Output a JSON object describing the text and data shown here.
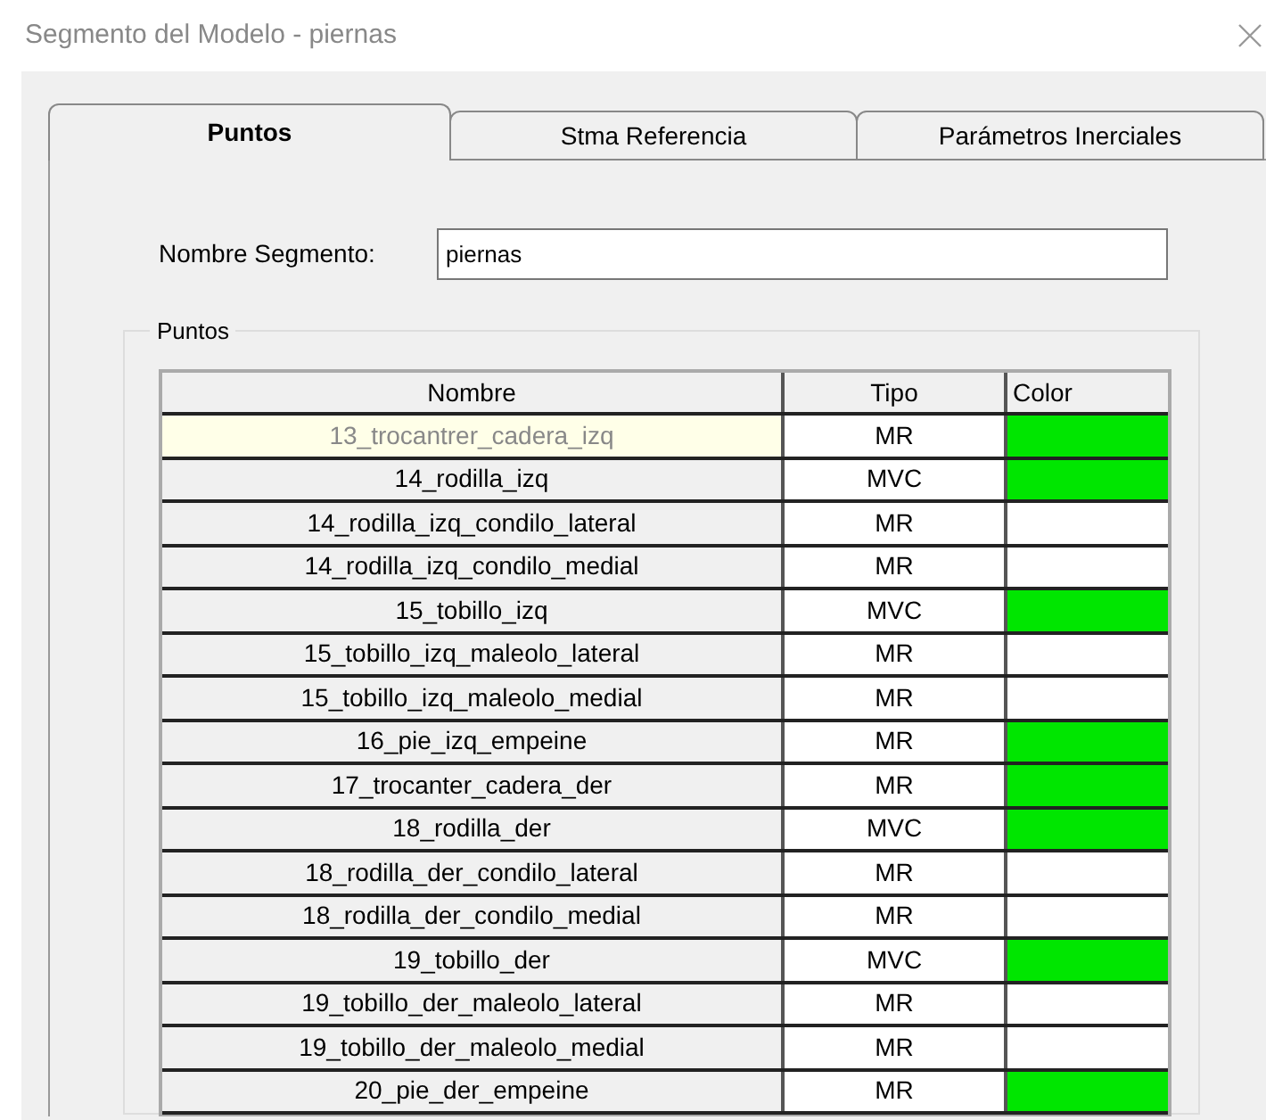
{
  "window": {
    "title": "Segmento del Modelo - piernas"
  },
  "tabs": [
    {
      "label": "Puntos",
      "selected": true
    },
    {
      "label": "Stma Referencia",
      "selected": false
    },
    {
      "label": "Parámetros Inerciales",
      "selected": false
    }
  ],
  "segment_name": {
    "label": "Nombre Segmento:",
    "value": "piernas"
  },
  "points_group": {
    "title": "Puntos",
    "columns": [
      "Nombre",
      "Tipo",
      "Color"
    ],
    "rows": [
      {
        "nombre": "13_trocantrer_cadera_izq",
        "tipo": "MR",
        "color": "#00e600",
        "selected": true
      },
      {
        "nombre": "14_rodilla_izq",
        "tipo": "MVC",
        "color": "#00e600",
        "selected": false
      },
      {
        "nombre": "14_rodilla_izq_condilo_lateral",
        "tipo": "MR",
        "selected": false
      },
      {
        "nombre": "14_rodilla_izq_condilo_medial",
        "tipo": "MR",
        "selected": false
      },
      {
        "nombre": "15_tobillo_izq",
        "tipo": "MVC",
        "color": "#00e600",
        "selected": false
      },
      {
        "nombre": "15_tobillo_izq_maleolo_lateral",
        "tipo": "MR",
        "selected": false
      },
      {
        "nombre": "15_tobillo_izq_maleolo_medial",
        "tipo": "MR",
        "selected": false
      },
      {
        "nombre": "16_pie_izq_empeine",
        "tipo": "MR",
        "color": "#00e600",
        "selected": false
      },
      {
        "nombre": "17_trocanter_cadera_der",
        "tipo": "MR",
        "color": "#00e600",
        "selected": false
      },
      {
        "nombre": "18_rodilla_der",
        "tipo": "MVC",
        "color": "#00e600",
        "selected": false
      },
      {
        "nombre": "18_rodilla_der_condilo_lateral",
        "tipo": "MR",
        "selected": false
      },
      {
        "nombre": "18_rodilla_der_condilo_medial",
        "tipo": "MR",
        "selected": false
      },
      {
        "nombre": "19_tobillo_der",
        "tipo": "MVC",
        "color": "#00e600",
        "selected": false
      },
      {
        "nombre": "19_tobillo_der_maleolo_lateral",
        "tipo": "MR",
        "selected": false
      },
      {
        "nombre": "19_tobillo_der_maleolo_medial",
        "tipo": "MR",
        "selected": false
      },
      {
        "nombre": "20_pie_der_empeine",
        "tipo": "MR",
        "color": "#00e600",
        "selected": false
      }
    ]
  }
}
